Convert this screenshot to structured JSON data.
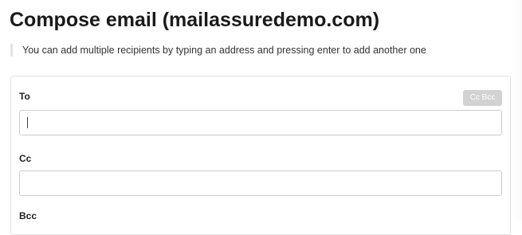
{
  "title": "Compose email (mailassuredemo.com)",
  "info": "You can add multiple recipients by typing an address and pressing enter to add another one",
  "form": {
    "to_label": "To",
    "to_value": "",
    "cc_bcc_button": "Cc Bcc",
    "cc_label": "Cc",
    "cc_value": "",
    "bcc_label": "Bcc"
  }
}
